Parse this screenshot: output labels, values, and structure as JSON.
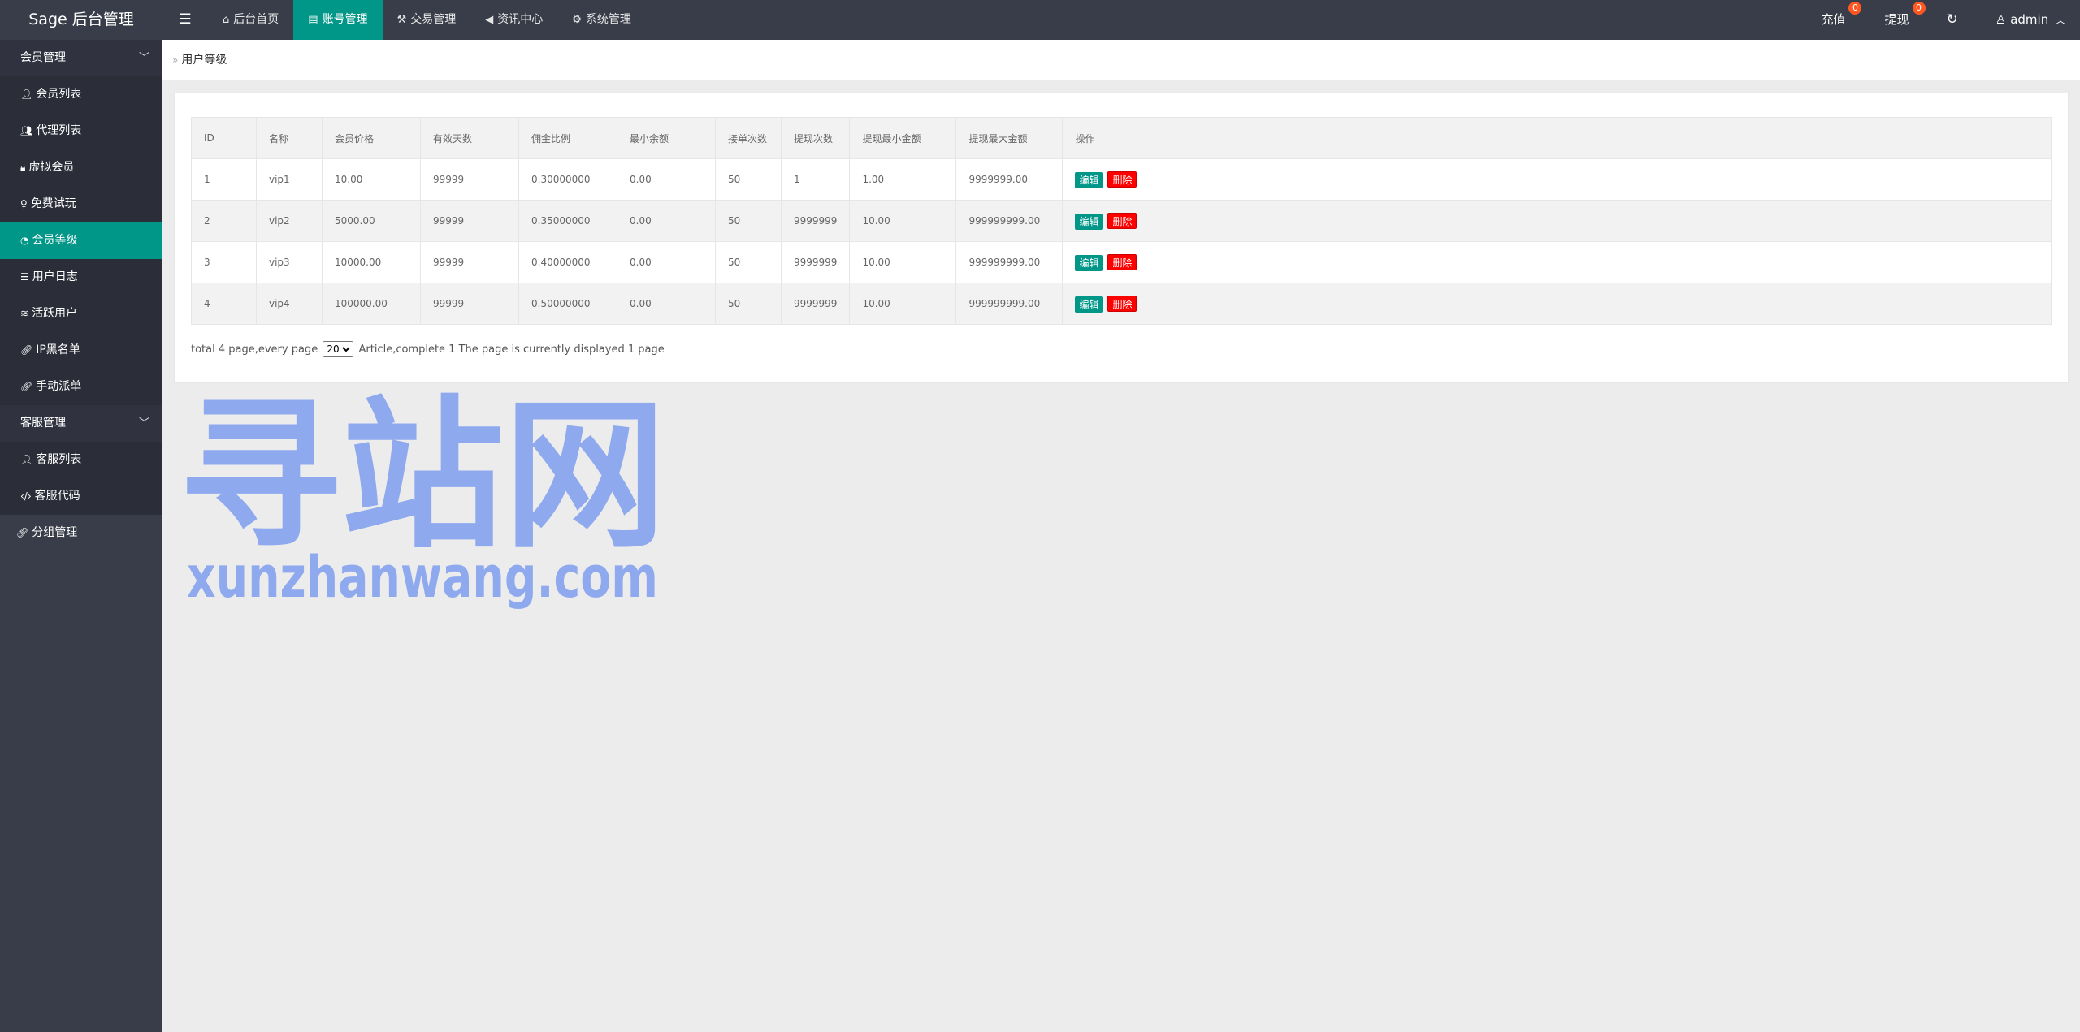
{
  "header": {
    "logo": "Sage 后台管理",
    "menu_toggle_icon": "hamburger-icon",
    "nav": [
      {
        "label": "后台首页",
        "icon": "home-icon"
      },
      {
        "label": "账号管理",
        "icon": "id-card-icon",
        "active": true
      },
      {
        "label": "交易管理",
        "icon": "gavel-icon"
      },
      {
        "label": "资讯中心",
        "icon": "megaphone-icon"
      },
      {
        "label": "系统管理",
        "icon": "gears-icon"
      }
    ],
    "recharge": {
      "label": "充值",
      "badge": "0"
    },
    "withdraw": {
      "label": "提现",
      "badge": "0"
    },
    "refresh_icon": "refresh-icon",
    "user": {
      "label": "admin",
      "icon": "user-icon",
      "chevron": "chevron-up-icon"
    }
  },
  "sidebar": {
    "group1": {
      "label": "会员管理",
      "items": [
        {
          "label": "会员列表",
          "icon": "user-icon"
        },
        {
          "label": "代理列表",
          "icon": "users-icon"
        },
        {
          "label": "虚拟会员",
          "icon": "lock-icon"
        },
        {
          "label": "免费试玩",
          "icon": "female-icon"
        },
        {
          "label": "会员等级",
          "icon": "dashboard-icon",
          "active": true
        },
        {
          "label": "用户日志",
          "icon": "list-icon"
        },
        {
          "label": "活跃用户",
          "icon": "wifi-icon"
        },
        {
          "label": "IP黑名单",
          "icon": "link-icon"
        },
        {
          "label": "手动派单",
          "icon": "link-icon"
        }
      ]
    },
    "group2": {
      "label": "客服管理",
      "items": [
        {
          "label": "客服列表",
          "icon": "user-icon"
        },
        {
          "label": "客服代码",
          "icon": "code-icon"
        }
      ]
    },
    "single": {
      "label": "分组管理",
      "icon": "link-icon"
    }
  },
  "breadcrumb": {
    "current": "用户等级"
  },
  "table": {
    "headers": [
      "ID",
      "名称",
      "会员价格",
      "有效天数",
      "佣金比例",
      "最小余额",
      "接单次数",
      "提现次数",
      "提现最小金额",
      "提现最大金额",
      "操作"
    ],
    "rows": [
      [
        "1",
        "vip1",
        "10.00",
        "99999",
        "0.30000000",
        "0.00",
        "50",
        "1",
        "1.00",
        "9999999.00"
      ],
      [
        "2",
        "vip2",
        "5000.00",
        "99999",
        "0.35000000",
        "0.00",
        "50",
        "9999999",
        "10.00",
        "999999999.00"
      ],
      [
        "3",
        "vip3",
        "10000.00",
        "99999",
        "0.40000000",
        "0.00",
        "50",
        "9999999",
        "10.00",
        "999999999.00"
      ],
      [
        "4",
        "vip4",
        "100000.00",
        "99999",
        "0.50000000",
        "0.00",
        "50",
        "9999999",
        "10.00",
        "999999999.00"
      ]
    ],
    "edit_label": "编辑",
    "delete_label": "删除"
  },
  "pager": {
    "prefix": "total 4 page,every page",
    "page_size": "20",
    "suffix": "Article,complete 1 The page is currently displayed 1 page"
  },
  "watermark": {
    "line1": "寻站网",
    "line2": "xunzhanwang.com"
  },
  "colors": {
    "header_bg": "#393d49",
    "accent": "#009688",
    "delete": "#ff0000",
    "badge": "#ff5722",
    "watermark": "#8fa9ef"
  }
}
